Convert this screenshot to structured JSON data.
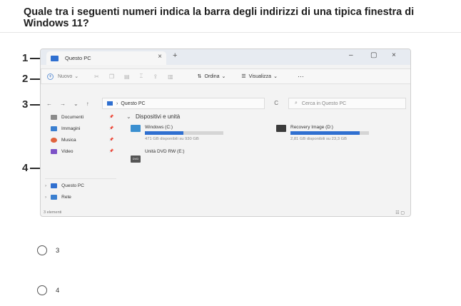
{
  "question": "Quale tra i seguenti numeri indica la barra degli indirizzi di una tipica finestra di Windows 11?",
  "markers": [
    "1",
    "2",
    "3",
    "4"
  ],
  "window": {
    "tab_title": "Questo PC",
    "tab_close": "×",
    "tab_add": "+",
    "minimize": "–",
    "maximize": "▢",
    "close": "×"
  },
  "toolbar": {
    "new_label": "Nuovo",
    "new_caret": "⌄",
    "sort_label": "Ordina",
    "view_label": "Visualizza",
    "more": "···",
    "icons": [
      "cut-icon",
      "copy-icon",
      "paste-icon",
      "rename-icon",
      "share-icon",
      "delete-icon"
    ]
  },
  "address": {
    "back": "←",
    "forward": "→",
    "recent": "⌄",
    "up": "↑",
    "path": "Questo PC",
    "chevron": "›",
    "refresh": "C",
    "search_placeholder": "Cerca in Questo PC"
  },
  "sidebar": {
    "items": [
      {
        "label": "Documenti",
        "icon": "documents-icon",
        "color": "#8b8b8b"
      },
      {
        "label": "Immagini",
        "icon": "pictures-icon",
        "color": "#3a7fd0"
      },
      {
        "label": "Musica",
        "icon": "music-icon",
        "color": "#e0633d"
      },
      {
        "label": "Video",
        "icon": "videos-icon",
        "color": "#7d52c7"
      },
      {
        "label": "Questo PC",
        "icon": "this-pc-icon",
        "color": "#2f6fd0"
      },
      {
        "label": "Rete",
        "icon": "network-icon",
        "color": "#3a7fd0"
      }
    ]
  },
  "content": {
    "section_title": "Dispositivi e unità",
    "drives": [
      {
        "name": "Windows (C:)",
        "info": "471 GB disponibili su 930 GB",
        "used_fraction": 0.49
      },
      {
        "name": "Recovery Image (D:)",
        "info": "2,81 GB disponibili su 23,3 GB",
        "used_fraction": 0.88
      },
      {
        "name": "Unità DVD RW (E:)",
        "info": "",
        "used_fraction": null
      }
    ],
    "dvd_label": "DVD"
  },
  "status": {
    "count": "3 elementi",
    "view_icons": "☷ ▢"
  },
  "options": [
    {
      "label": "3"
    },
    {
      "label": "4"
    }
  ]
}
